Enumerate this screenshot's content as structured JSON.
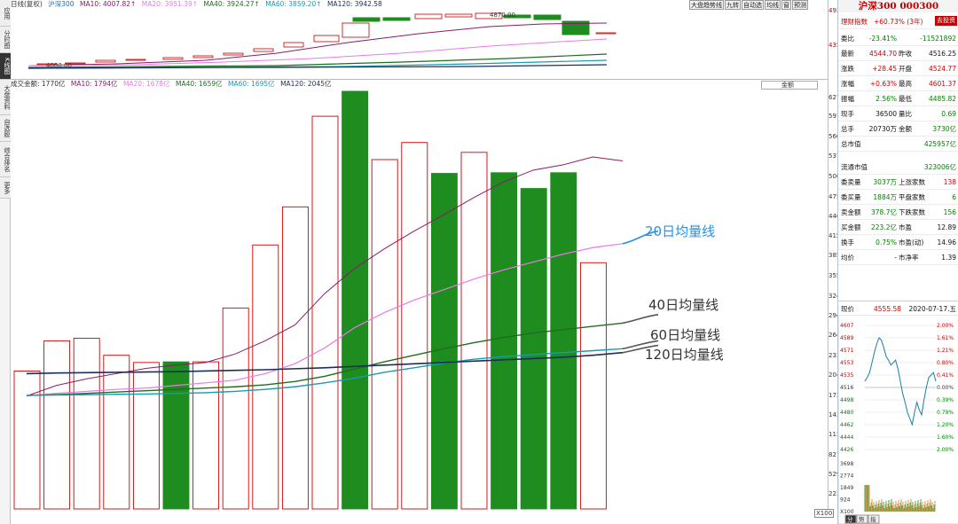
{
  "left_tabs": [
    "应用",
    "分时图",
    "K线图",
    "大盘资料",
    "自选股",
    "综合排名",
    "更多"
  ],
  "kline_legend": {
    "name": "日线(复权)",
    "index": "沪深300",
    "ma10": "MA10: 4007.82↑",
    "ma20": "MA20: 3951.39↑",
    "ma40": "MA40: 3924.27↑",
    "ma60": "MA60: 3859.20↑",
    "ma120": "MA120: 3942.58",
    "high_mark": "4870.00",
    "low_mark": "4000.00"
  },
  "toolbar": [
    "大盘趋势线",
    "九转",
    "自动选",
    "均线",
    "窗",
    "预测"
  ],
  "kline_axis": [
    "4936",
    "4358"
  ],
  "volume_legend": {
    "name": "成交金额: 1770亿",
    "ma10": "MA10: 1794亿",
    "ma20": "MA20: 1678亿",
    "ma40": "MA40: 1659亿",
    "ma60": "MA60: 1695亿",
    "ma120": "MA120: 2045亿",
    "selector": "金额"
  },
  "volume_axis": [
    "6271",
    "5977",
    "5667",
    "5370",
    "5064",
    "4759",
    "4461",
    "4156",
    "3858",
    "3552",
    "3247",
    "2949",
    "2644",
    "2338",
    "2045",
    "1735",
    "1437",
    "1132",
    "827",
    "529",
    "223"
  ],
  "volume_unit": "X100",
  "annotations": {
    "ma20": "20日均量线",
    "ma40": "40日均量线",
    "ma60": "60日均量线",
    "ma120": "120日均量线"
  },
  "colors": {
    "up": "#d00000",
    "down": "#1e8c1e",
    "ma20": "#e87ae8",
    "ma40": "#1f6e1f",
    "ma60": "#1a9bb0",
    "ma120": "#1a2f5a",
    "ma10": "#8a1a6a"
  },
  "chart_data": {
    "type": "bar",
    "values_volume": [
      2100,
      2560,
      2600,
      2340,
      2230,
      2240,
      2240,
      3060,
      4020,
      4600,
      5980,
      6360,
      5320,
      5580,
      5110,
      5430,
      5120,
      4880,
      5120,
      3750
    ],
    "bar_color": [
      "up",
      "up",
      "up",
      "up",
      "up",
      "down",
      "up",
      "up",
      "up",
      "up",
      "up",
      "down",
      "up",
      "up",
      "down",
      "up",
      "down",
      "down",
      "down",
      "up"
    ],
    "ma10": [
      1720,
      1880,
      1980,
      2060,
      2140,
      2190,
      2230,
      2360,
      2560,
      2800,
      3280,
      3660,
      3960,
      4230,
      4480,
      4740,
      4980,
      5160,
      5240,
      5360,
      5300
    ],
    "ma20": [
      1720,
      1760,
      1790,
      1820,
      1840,
      1880,
      1920,
      1960,
      2060,
      2210,
      2450,
      2760,
      2990,
      3180,
      3340,
      3500,
      3640,
      3760,
      3880,
      3980,
      4040
    ],
    "ma40": [
      1730,
      1740,
      1760,
      1780,
      1800,
      1820,
      1840,
      1860,
      1890,
      1940,
      2020,
      2130,
      2240,
      2340,
      2440,
      2530,
      2610,
      2680,
      2730,
      2780,
      2830
    ],
    "ma60": [
      1730,
      1735,
      1740,
      1745,
      1750,
      1760,
      1770,
      1790,
      1820,
      1860,
      1920,
      1990,
      2080,
      2150,
      2220,
      2280,
      2320,
      2350,
      2380,
      2410,
      2440
    ],
    "ma120": [
      2060,
      2070,
      2075,
      2080,
      2085,
      2090,
      2100,
      2110,
      2120,
      2135,
      2150,
      2170,
      2190,
      2210,
      2230,
      2250,
      2270,
      2290,
      2310,
      2340,
      2380
    ],
    "ylim": [
      0,
      6400
    ]
  },
  "quote": {
    "title": "沪深300 000300",
    "rows": [
      {
        "c1": "理财指数",
        "v1": "+60.73%",
        "v1_extra": "(3年)",
        "btn": "去投资"
      },
      {
        "c1": "委比",
        "v1": "-23.41%",
        "v2": "-11521892"
      },
      {
        "c1": "最新",
        "v1": "4544.70",
        "c2": "昨收",
        "v2": "4516.25"
      },
      {
        "c1": "涨跌",
        "v1": "+28.45",
        "c2": "开盘",
        "v2": "4524.77"
      },
      {
        "c1": "涨幅",
        "v1": "+0.63%",
        "c2": "最高",
        "v2": "4601.37"
      },
      {
        "c1": "振幅",
        "v1": "2.56%",
        "c2": "最低",
        "v2": "4485.82"
      },
      {
        "c1": "现手",
        "v1": "36500",
        "c2": "量比",
        "v2": "0.69"
      },
      {
        "c1": "总手",
        "v1": "20730万",
        "c2": "金额",
        "v2": "3730亿"
      },
      {
        "c1": "总市值",
        "v2": "425957亿"
      },
      {
        "c1": "流通市值",
        "v2": "323006亿"
      },
      {
        "c1": "委卖量",
        "v1": "3037万",
        "c2": "上涨家数",
        "v2": "138"
      },
      {
        "c1": "委买量",
        "v1": "1884万",
        "c2": "平盘家数",
        "v2": "6"
      },
      {
        "c1": "卖金额",
        "v1": "378.7亿",
        "c2": "下跌家数",
        "v2": "156"
      },
      {
        "c1": "买金额",
        "v1": "223.2亿",
        "c2": "市盈",
        "v2": "12.89"
      },
      {
        "c1": "换手",
        "v1": "0.75%",
        "c2": "市盈(动)",
        "v2": "14.96"
      },
      {
        "c1": "均价",
        "v1": "-",
        "c2": "市净率",
        "v2": "1.39"
      }
    ],
    "now_label": "现价",
    "now_value": "4555.58",
    "date": "2020-07-17.五",
    "mini_left_axis": [
      "4607",
      "4589",
      "4571",
      "4553",
      "4535",
      "4516",
      "4498",
      "4480",
      "4462",
      "4444",
      "4426"
    ],
    "mini_right_axis": [
      "2.00%",
      "1.61%",
      "1.21%",
      "0.80%",
      "0.41%",
      "0.00%",
      "0.39%",
      "0.79%",
      "1.20%",
      "1.60%",
      "2.00%"
    ],
    "mini_vol_axis": [
      "3698",
      "2774",
      "1849",
      "924",
      "X100"
    ],
    "mini_tabs": [
      "分",
      "势",
      "指"
    ]
  }
}
